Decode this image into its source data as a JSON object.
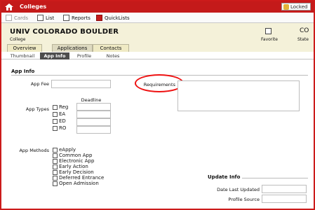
{
  "window": {
    "title": "Colleges",
    "locked_label": "Locked"
  },
  "toolbar": {
    "cards": "Cards",
    "list": "List",
    "reports": "Reports",
    "quicklists": "QuickLists"
  },
  "header": {
    "school_name": "UNIV COLORADO BOULDER",
    "subtitle": "College",
    "favorite_label": "Favorite",
    "state_value": "CO",
    "state_label": "State"
  },
  "tabs": [
    "Overview",
    "Applications",
    "Contacts"
  ],
  "subtabs": [
    "Thumbnail",
    "App Info",
    "Profile",
    "Notes"
  ],
  "app_info": {
    "section_title": "App Info",
    "app_fee_label": "App Fee",
    "requirements_label": "Requirements",
    "app_types_label": "App Types",
    "deadline_label": "Deadline",
    "app_types": [
      "Reg",
      "EA",
      "ED",
      "RO"
    ],
    "app_methods_label": "App Methods",
    "app_methods": [
      "eApply",
      "Common App",
      "Electronic App",
      "Early Action",
      "Early Decision",
      "Deferred Entrance",
      "Open Admission"
    ]
  },
  "update_info": {
    "title": "Update Info",
    "date_label": "Date Last Updated",
    "source_label": "Profile Source"
  },
  "colors": {
    "brand_red": "#c41a1a",
    "header_bg": "#f4f1d9",
    "annotation": "#ee1111"
  }
}
